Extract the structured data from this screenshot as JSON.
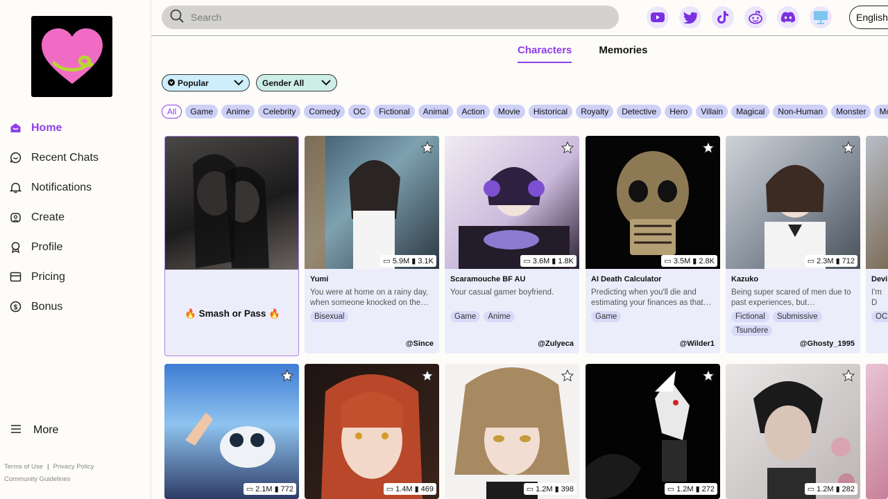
{
  "nav": [
    {
      "label": "Home",
      "icon": "home-icon"
    },
    {
      "label": "Recent Chats",
      "icon": "chat-icon"
    },
    {
      "label": "Notifications",
      "icon": "bell-icon"
    },
    {
      "label": "Create",
      "icon": "create-icon"
    },
    {
      "label": "Profile",
      "icon": "profile-icon"
    },
    {
      "label": "Pricing",
      "icon": "pricing-icon"
    },
    {
      "label": "Bonus",
      "icon": "bonus-icon"
    }
  ],
  "more_label": "More",
  "footer": {
    "terms": "Terms of Use",
    "privacy": "Privacy Policy",
    "guidelines": "Community Guidelines"
  },
  "search": {
    "placeholder": "Search"
  },
  "social_icons": [
    "youtube-icon",
    "twitter-icon",
    "tiktok-icon",
    "reddit-icon",
    "discord-icon",
    "desktop-icon"
  ],
  "language": "English",
  "tabs": [
    "Characters",
    "Memories"
  ],
  "filters": {
    "sort": "Popular",
    "gender": "Gender All"
  },
  "categories": [
    "All",
    "Game",
    "Anime",
    "Celebrity",
    "Comedy",
    "OC",
    "Fictional",
    "Animal",
    "Action",
    "Movie",
    "Historical",
    "Royalty",
    "Detective",
    "Hero",
    "Villain",
    "Magical",
    "Non-Human",
    "Monster",
    "More"
  ],
  "featured": {
    "label": "Smash or Pass"
  },
  "cards_row1": [
    {
      "name": "Yumi",
      "desc": "You were at home on a rainy day, when someone knocked on the…",
      "tags": [
        "Bisexual"
      ],
      "author": "@Since",
      "chats": "5.9M",
      "likes": "3.1K"
    },
    {
      "name": "Scaramouche BF AU",
      "desc": "Your casual gamer boyfriend.",
      "tags": [
        "Game",
        "Anime"
      ],
      "author": "@Zulyeca",
      "chats": "3.6M",
      "likes": "1.8K"
    },
    {
      "name": "AI Death Calculator",
      "desc": "Predicting when you'll die and estimating your finances as that…",
      "tags": [
        "Game"
      ],
      "author": "@Wilder1",
      "chats": "3.5M",
      "likes": "2.8K"
    },
    {
      "name": "Kazuko",
      "desc": "Being super scared of men due to past experiences, but…",
      "tags": [
        "Fictional",
        "Submissive",
        "Tsundere"
      ],
      "author": "@Ghosty_1995",
      "chats": "2.3M",
      "likes": "712"
    },
    {
      "name": "Devi",
      "desc": "I'm D stack",
      "tags": [
        "OC"
      ],
      "author": "",
      "chats": "",
      "likes": ""
    }
  ],
  "cards_row2": [
    {
      "chats": "2.1M",
      "likes": "772"
    },
    {
      "chats": "1.4M",
      "likes": "469"
    },
    {
      "chats": "1.2M",
      "likes": "398"
    },
    {
      "chats": "1.2M",
      "likes": "272"
    },
    {
      "chats": "1.2M",
      "likes": "282"
    }
  ],
  "colors": {
    "accent": "#8e3fe8",
    "chip": "#cdd0f7",
    "card": "#ecedfb",
    "logo_heart": "#f06bc4"
  }
}
